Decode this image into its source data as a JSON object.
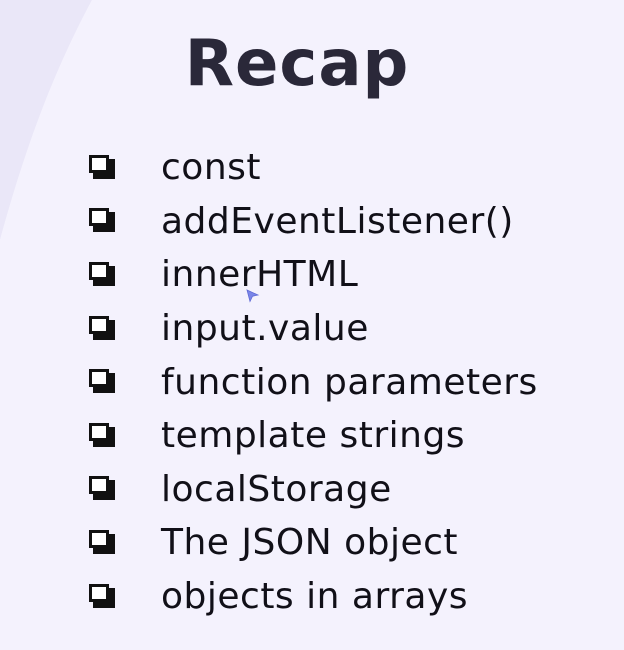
{
  "slide": {
    "title": "Recap",
    "items": [
      {
        "label": "const",
        "icon": "checkbox-icon"
      },
      {
        "label": "addEventListener()",
        "icon": "checkbox-icon"
      },
      {
        "label": "innerHTML",
        "icon": "checkbox-icon"
      },
      {
        "label": "input.value",
        "icon": "checkbox-icon"
      },
      {
        "label": "function parameters",
        "icon": "checkbox-icon"
      },
      {
        "label": "template strings",
        "icon": "checkbox-icon"
      },
      {
        "label": "localStorage",
        "icon": "checkbox-icon"
      },
      {
        "label": "The JSON object",
        "icon": "checkbox-icon"
      },
      {
        "label": "objects in arrays",
        "icon": "checkbox-icon"
      }
    ]
  },
  "colors": {
    "background": "#f4f2fd",
    "title": "#2a2839",
    "text": "#111018",
    "cursor": "#7a86e8"
  }
}
